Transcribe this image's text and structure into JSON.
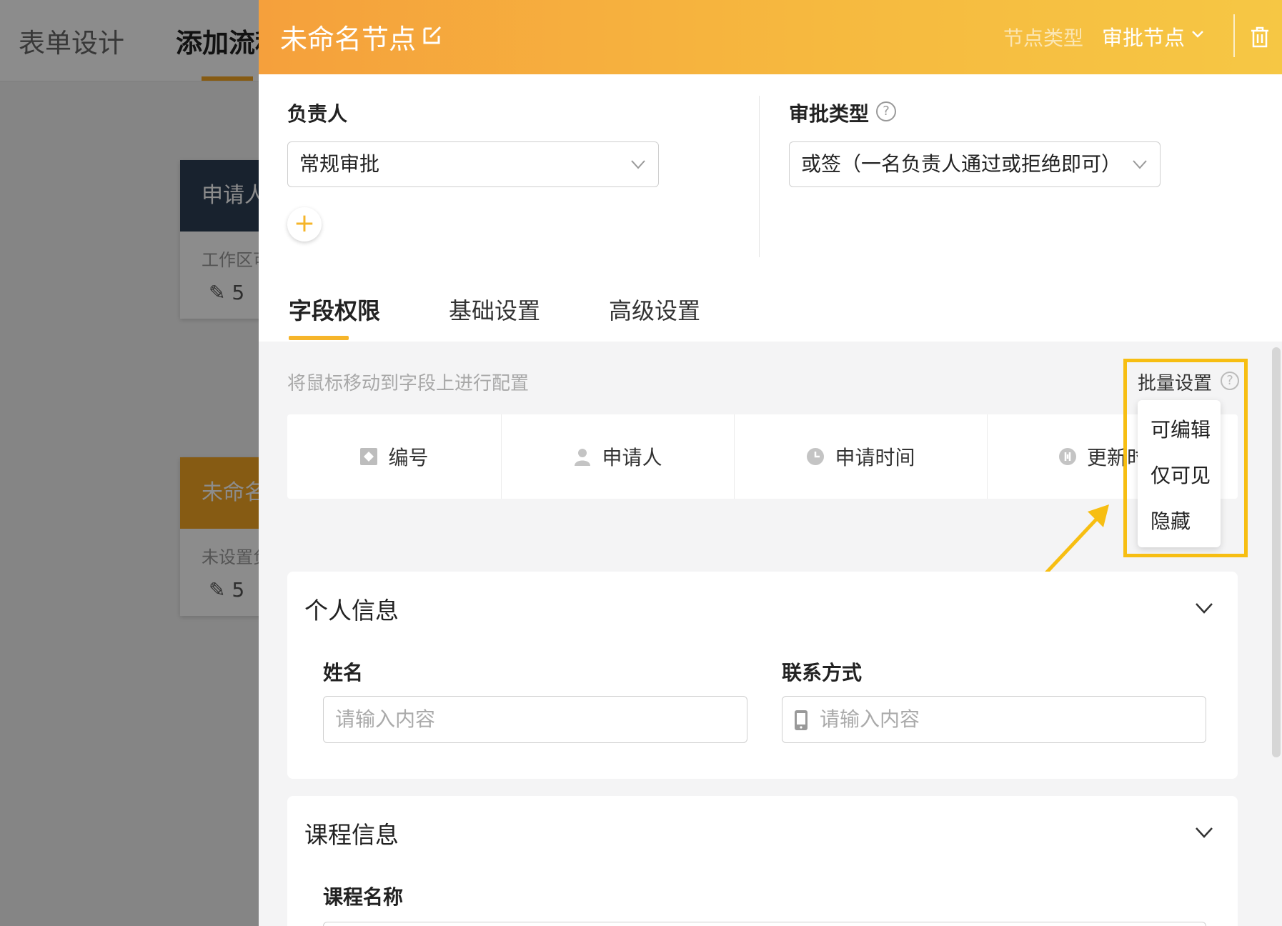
{
  "background": {
    "tabs": [
      "表单设计",
      "添加流程"
    ],
    "cards": [
      {
        "title": "申请人",
        "subtitle": "工作区可",
        "count": "5",
        "color": "#2c3e55"
      },
      {
        "title": "未命名节点",
        "subtitle": "未设置负",
        "count": "5",
        "color": "#f5a623"
      }
    ]
  },
  "header": {
    "node_title": "未命名节点",
    "node_type_label": "节点类型",
    "node_type_value": "审批节点"
  },
  "settings": {
    "owner_label": "负责人",
    "owner_value": "常规审批",
    "approval_type_label": "审批类型",
    "approval_type_value": "或签（一名负责人通过或拒绝即可）",
    "help": "?",
    "add": "+"
  },
  "tabs": [
    {
      "label": "字段权限",
      "active": true
    },
    {
      "label": "基础设置",
      "active": false
    },
    {
      "label": "高级设置",
      "active": false
    }
  ],
  "permissions": {
    "hint": "将鼠标移动到字段上进行配置",
    "batch_label": "批量设置",
    "batch_options": [
      "可编辑",
      "仅可见",
      "隐藏"
    ],
    "system_fields": [
      {
        "label": "编号",
        "icon": "id-icon"
      },
      {
        "label": "申请人",
        "icon": "user-icon"
      },
      {
        "label": "申请时间",
        "icon": "clock-icon"
      },
      {
        "label": "更新时间",
        "icon": "update-icon"
      }
    ]
  },
  "sections": [
    {
      "title": "个人信息",
      "fields": [
        {
          "label": "姓名",
          "placeholder": "请输入内容"
        },
        {
          "label": "联系方式",
          "placeholder": "请输入内容"
        }
      ]
    },
    {
      "title": "课程信息",
      "fields": [
        {
          "label": "课程名称"
        }
      ]
    }
  ],
  "colors": {
    "accent": "#f6b52a",
    "highlight": "#f7be12",
    "header_start": "#f5a03c",
    "header_end": "#f6c744"
  }
}
